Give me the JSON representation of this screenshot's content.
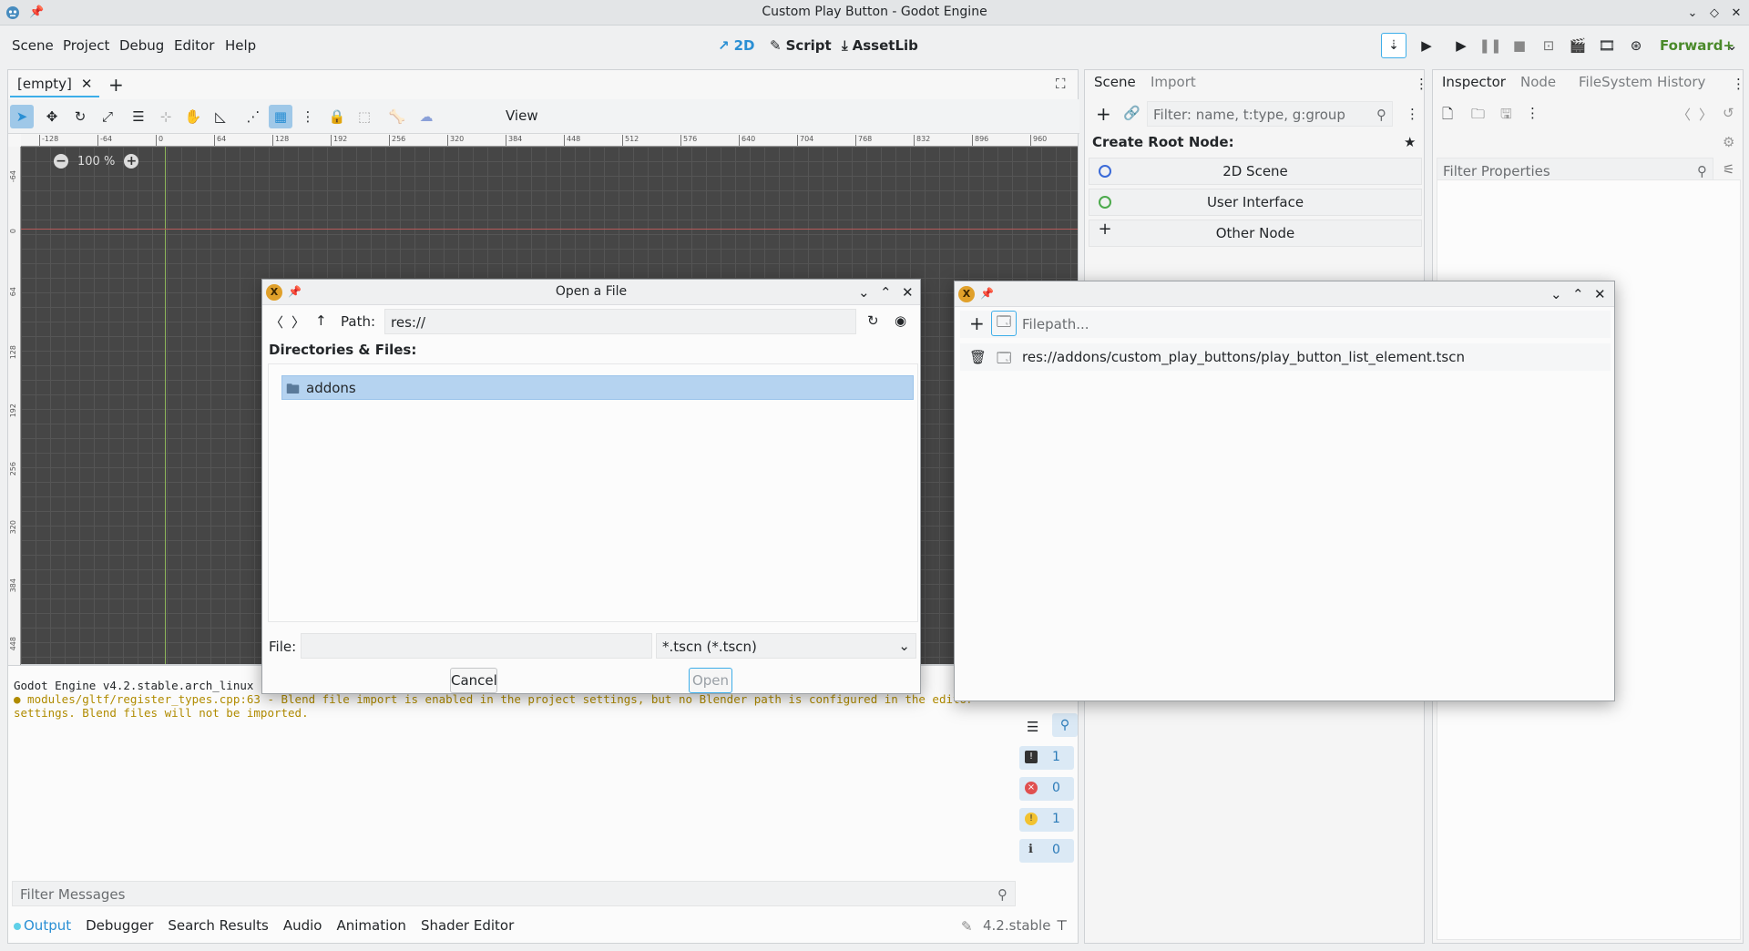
{
  "window": {
    "title": "Custom Play Button - Godot Engine"
  },
  "menu": {
    "items": [
      "Scene",
      "Project",
      "Debug",
      "Editor",
      "Help"
    ]
  },
  "workspaces": {
    "w2d": "2D",
    "script": "Script",
    "assetlib": "AssetLib"
  },
  "renderer": "Forward+",
  "editor": {
    "scene_tab": "[empty]",
    "view_label": "View",
    "zoom": "100 %",
    "ruler_top": [
      "-128",
      "-64",
      "0",
      "64",
      "128",
      "192",
      "256",
      "320",
      "384",
      "448",
      "512",
      "576",
      "640",
      "704",
      "768",
      "832",
      "896",
      "960"
    ],
    "ruler_left": [
      "-64",
      "0",
      "64",
      "128",
      "192",
      "256",
      "320",
      "384",
      "448"
    ]
  },
  "output": {
    "line1": "Godot Engine v4.2.stable.arch_linux",
    "line2": "● modules/gltf/register_types.cpp:63 - Blend file import is enabled in the project settings, but no Blender path is configured in the editor",
    "line3": "settings. Blend files will not be imported.",
    "filter_placeholder": "Filter Messages",
    "counts": {
      "messages": "1",
      "errors": "0",
      "warnings": "1",
      "info": "0"
    },
    "tabs": [
      "Output",
      "Debugger",
      "Search Results",
      "Audio",
      "Animation",
      "Shader Editor"
    ],
    "version": "4.2.stable"
  },
  "scene_dock": {
    "tabs": [
      "Scene",
      "Import"
    ],
    "filter_placeholder": "Filter: name, t:type, g:group",
    "create_root_label": "Create Root Node:",
    "root_options": [
      "2D Scene",
      "User Interface",
      "Other Node"
    ]
  },
  "inspector_dock": {
    "tabs": [
      "Inspector",
      "Node",
      "FileSystem",
      "History"
    ],
    "filter_placeholder": "Filter Properties"
  },
  "open_file_dialog": {
    "title": "Open a File",
    "path_label": "Path:",
    "path_value": "res://",
    "dirs_label": "Directories & Files:",
    "entries": [
      "addons"
    ],
    "file_label": "File:",
    "file_value": "",
    "filter_value": "*.tscn (*.tscn)",
    "cancel": "Cancel",
    "open": "Open"
  },
  "play_buttons_window": {
    "filepath_placeholder": "Filepath...",
    "entries": [
      "res://addons/custom_play_buttons/play_button_list_element.tscn"
    ]
  },
  "colors": {
    "accent": "#3daee9",
    "selection": "#b5d3f0",
    "viewport_bg": "#464646",
    "warning": "#b08b00"
  }
}
